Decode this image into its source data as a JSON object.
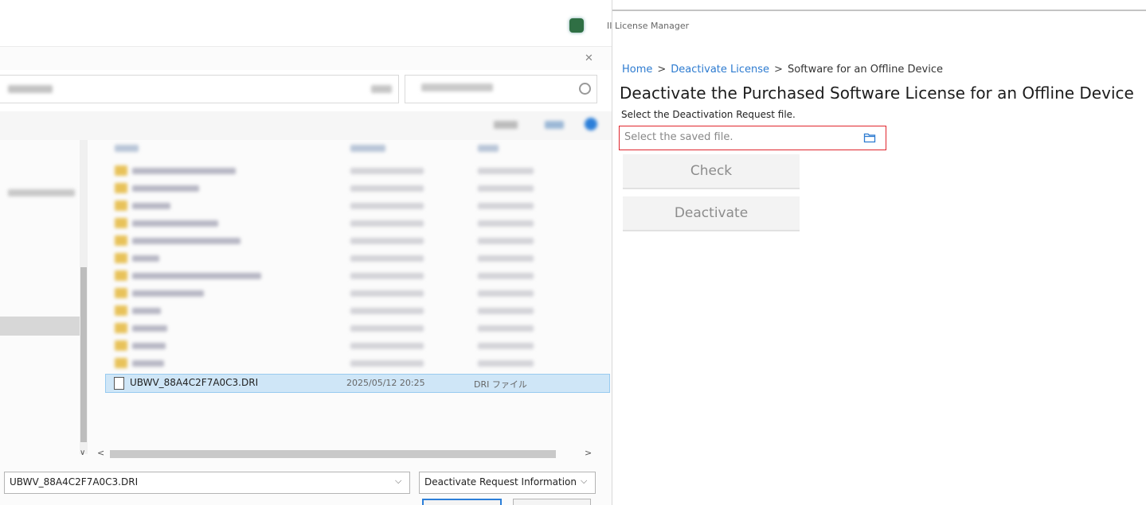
{
  "dialog": {
    "selected_file": {
      "name": "UBWV_88A4C2F7A0C3.DRI",
      "date": "2025/05/12 20:25",
      "type": "DRI ファイル"
    },
    "filename_value": "UBWV_88A4C2F7A0C3.DRI",
    "filetype_value": "Deactivate Request Information",
    "icons": {
      "close": "✕",
      "dropdown": "⌵",
      "scroll_down": "∨",
      "scroll_left": "<",
      "scroll_right": ">"
    }
  },
  "license_manager": {
    "window_title": "II License Manager",
    "breadcrumb": {
      "home": "Home",
      "sep1": ">",
      "deactivate": "Deactivate License",
      "sep2": ">",
      "current": "Software for an Offline Device"
    },
    "heading": "Deactivate the Purchased Software License for an Offline Device",
    "instruction": "Select the Deactivation Request file.",
    "file_input_placeholder": "Select the saved file.",
    "buttons": {
      "check": "Check",
      "deactivate": "Deactivate"
    },
    "colors": {
      "link": "#2d7bd0",
      "highlight_border": "#e0252c"
    }
  }
}
